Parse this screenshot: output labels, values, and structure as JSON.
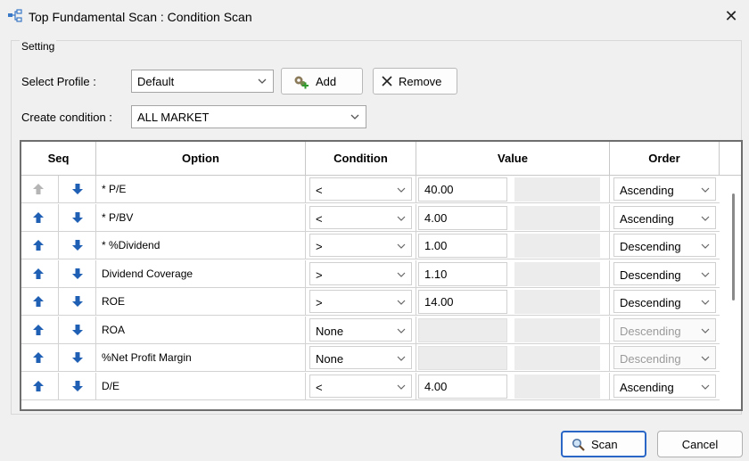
{
  "window": {
    "title": "Top Fundamental Scan : Condition Scan",
    "close_glyph": "✕"
  },
  "group": {
    "legend": "Setting"
  },
  "profile": {
    "label": "Select Profile :",
    "value": "Default",
    "add_label": "Add",
    "remove_label": "Remove"
  },
  "create_condition": {
    "label": "Create condition :",
    "value": "ALL MARKET"
  },
  "table": {
    "headers": {
      "seq": "Seq",
      "option": "Option",
      "condition": "Condition",
      "value": "Value",
      "order": "Order"
    },
    "rows": [
      {
        "up_enabled": false,
        "option": "* P/E",
        "condition": "<",
        "value": "40.00",
        "order": "Ascending",
        "order_enabled": true
      },
      {
        "up_enabled": true,
        "option": "* P/BV",
        "condition": "<",
        "value": "4.00",
        "order": "Ascending",
        "order_enabled": true
      },
      {
        "up_enabled": true,
        "option": "* %Dividend",
        "condition": ">",
        "value": "1.00",
        "order": "Descending",
        "order_enabled": true
      },
      {
        "up_enabled": true,
        "option": "Dividend Coverage",
        "condition": ">",
        "value": "1.10",
        "order": "Descending",
        "order_enabled": true
      },
      {
        "up_enabled": true,
        "option": "ROE",
        "condition": ">",
        "value": "14.00",
        "order": "Descending",
        "order_enabled": true
      },
      {
        "up_enabled": true,
        "option": "ROA",
        "condition": "None",
        "value": "",
        "order": "Descending",
        "order_enabled": false
      },
      {
        "up_enabled": true,
        "option": "%Net Profit Margin",
        "condition": "None",
        "value": "",
        "order": "Descending",
        "order_enabled": false
      },
      {
        "up_enabled": true,
        "option": "D/E",
        "condition": "<",
        "value": "4.00",
        "order": "Ascending",
        "order_enabled": true
      }
    ]
  },
  "footer": {
    "scan_label": "Scan",
    "cancel_label": "Cancel"
  },
  "colors": {
    "arrow_active": "#1f5fb4",
    "arrow_disabled": "#b5b5b5"
  }
}
